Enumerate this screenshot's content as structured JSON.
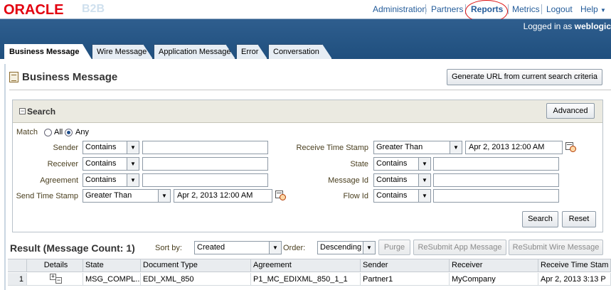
{
  "brand": {
    "oracle": "ORACLE",
    "product": "B2B"
  },
  "header": {
    "links": [
      "Administration",
      "Partners",
      "Reports",
      "Metrics",
      "Logout"
    ],
    "help": "Help",
    "logged_in": "Logged in as",
    "user": "weblogic"
  },
  "tabs": [
    "Business Message",
    "Wire Message",
    "Application Message",
    "Error",
    "Conversation"
  ],
  "page": {
    "title": "Business Message",
    "generate_url_button": "Generate URL from current search criteria"
  },
  "search": {
    "title": "Search",
    "advanced_button": "Advanced",
    "match_label": "Match",
    "match_all": "All",
    "match_any": "Any",
    "fields_left": [
      {
        "label": "Sender",
        "operator": "Contains",
        "value": ""
      },
      {
        "label": "Receiver",
        "operator": "Contains",
        "value": ""
      },
      {
        "label": "Agreement",
        "operator": "Contains",
        "value": ""
      },
      {
        "label": "Send Time Stamp",
        "operator": "Greater Than",
        "value": "Apr 2, 2013 12:00 AM"
      }
    ],
    "fields_right": [
      {
        "label": "Receive Time Stamp",
        "operator": "Greater Than",
        "value": "Apr 2, 2013 12:00 AM"
      },
      {
        "label": "State",
        "operator": "Contains",
        "value": ""
      },
      {
        "label": "Message Id",
        "operator": "Contains",
        "value": ""
      },
      {
        "label": "Flow Id",
        "operator": "Contains",
        "value": ""
      }
    ],
    "search_button": "Search",
    "reset_button": "Reset"
  },
  "result": {
    "title": "Result (Message Count: 1)",
    "sort_by_label": "Sort by:",
    "sort_by_value": "Created",
    "order_label": "Order:",
    "order_value": "Descending",
    "purge_button": "Purge",
    "resubmit_app_button": "ReSubmit App Message",
    "resubmit_wire_button": "ReSubmit Wire Message",
    "columns": [
      "",
      "Details",
      "State",
      "Document Type",
      "Agreement",
      "Sender",
      "Receiver",
      "Receive Time Stam"
    ],
    "rows": [
      [
        "1",
        "",
        "MSG_COMPL...",
        "EDI_XML_850",
        "P1_MC_EDIXML_850_1_1",
        "Partner1",
        "MyCompany",
        "Apr 2, 2013 3:13 P"
      ]
    ]
  }
}
